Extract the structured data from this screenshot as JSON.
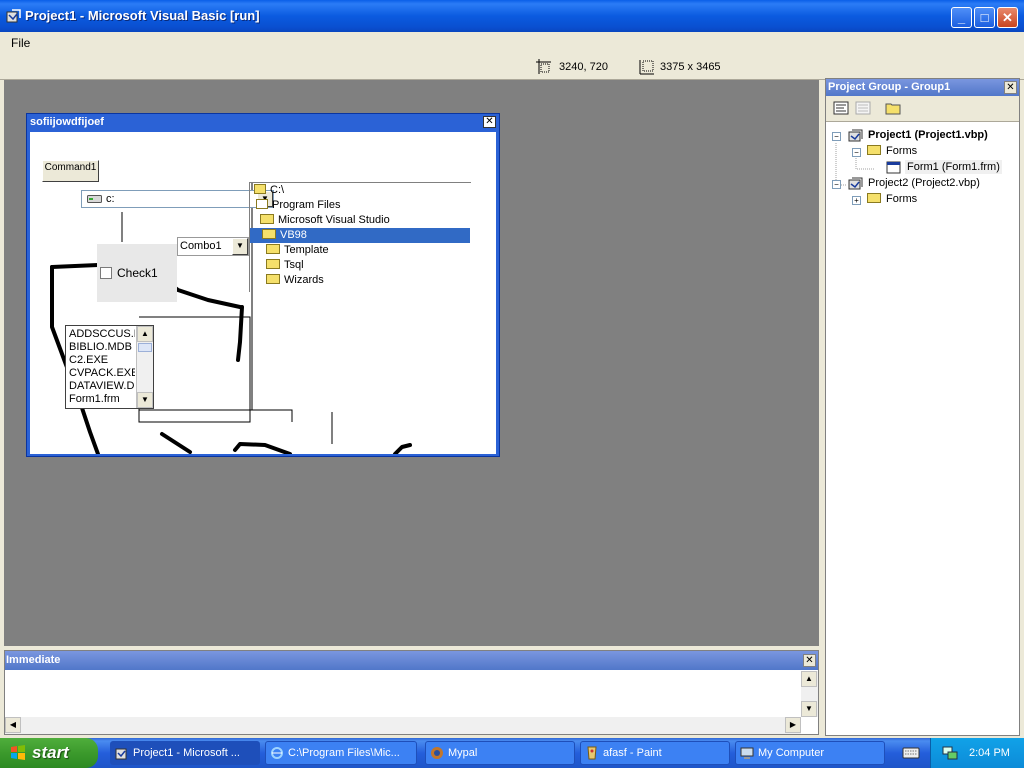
{
  "window": {
    "title": "Project1 - Microsoft Visual Basic [run]",
    "menu_file": "File"
  },
  "toolbar": {
    "position": "3240, 720",
    "size": "3375 x 3465"
  },
  "form": {
    "title": "sofiijowdfijoef",
    "command_label": "Command1",
    "drive": "c:",
    "check_label": "Check1",
    "combo_value": "Combo1",
    "dir_tree": [
      "C:\\",
      "Program Files",
      "Microsoft Visual Studio",
      "VB98",
      "Template",
      "Tsql",
      "Wizards"
    ],
    "dir_selected": "VB98",
    "files": [
      "ADDSCCUS.DLL",
      "BIBLIO.MDB",
      "C2.EXE",
      "CVPACK.EXE",
      "DATAVIEW.DLL",
      "Form1.frm"
    ]
  },
  "project_group": {
    "title": "Project Group - Group1",
    "tree": [
      {
        "label": "Project1 (Project1.vbp)",
        "bold": true
      },
      {
        "label": "Forms"
      },
      {
        "label": "Form1 (Form1.frm)"
      },
      {
        "label": "Project2 (Project2.vbp)"
      },
      {
        "label": "Forms"
      }
    ]
  },
  "immediate": {
    "title": "Immediate",
    "content": ""
  },
  "taskbar": {
    "start_label": "start",
    "tasks": [
      {
        "label": "Project1 - Microsoft ...",
        "icon": "vb-icon"
      },
      {
        "label": "C:\\Program Files\\Mic...",
        "icon": "ie-icon"
      },
      {
        "label": "Mypal",
        "icon": "browser-icon"
      },
      {
        "label": "afasf - Paint",
        "icon": "paint-icon"
      },
      {
        "label": "My Computer",
        "icon": "computer-icon"
      }
    ],
    "clock": "2:04 PM"
  },
  "colors": {
    "titlebar": "#0a5fe8",
    "mdi_background": "#808080",
    "selection": "#316ac5",
    "taskbar": "#245edb",
    "start_button": "#3c9a2c"
  }
}
